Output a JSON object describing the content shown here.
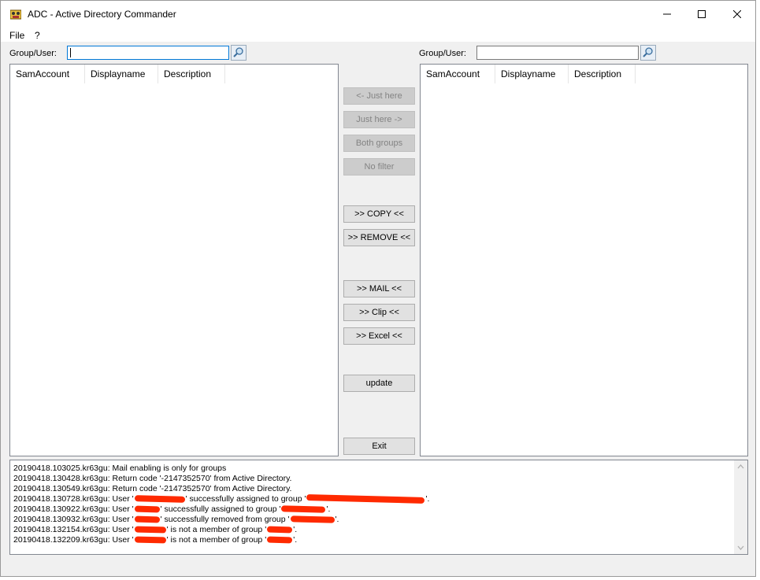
{
  "window": {
    "title": "ADC - Active Directory Commander"
  },
  "menu": [
    "File",
    "?"
  ],
  "left_panel": {
    "label": "Group/User:",
    "input_value": "",
    "columns": [
      "SamAccount",
      "Displayname",
      "Description"
    ]
  },
  "right_panel": {
    "label": "Group/User:",
    "input_value": "",
    "columns": [
      "SamAccount",
      "Displayname",
      "Description"
    ]
  },
  "buttons": {
    "just_here_left": "<- Just here",
    "just_here_right": "Just here ->",
    "both_groups": "Both groups",
    "no_filter": "No filter",
    "copy": ">> COPY <<",
    "remove": ">> REMOVE <<",
    "mail": ">> MAIL <<",
    "clip": ">> Clip <<",
    "excel": ">> Excel <<",
    "update": "update",
    "exit": "Exit"
  },
  "log": [
    {
      "pre": "20190418.103025.kr63gu: Mail enabling is only for groups"
    },
    {
      "pre": "20190418.130428.kr63gu: Return code '-2147352570' from Active Directory."
    },
    {
      "pre": "20190418.130549.kr63gu: Return code '-2147352570' from Active Directory."
    },
    {
      "pre": "20190418.130728.kr63gu: User '",
      "mid": "' successfully assigned to group '",
      "post": "'."
    },
    {
      "pre": "20190418.130922.kr63gu: User '",
      "mid": "' successfully assigned to group '",
      "post": "'."
    },
    {
      "pre": "20190418.130932.kr63gu: User '",
      "mid": "' successfully removed from group '",
      "post": "'."
    },
    {
      "pre": "20190418.132154.kr63gu: User '",
      "mid": "' is not a member of group '",
      "post": "'."
    },
    {
      "pre": "20190418.132209.kr63gu: User '",
      "mid": "' is not a member of group '",
      "post": "'."
    }
  ],
  "colors": {
    "redaction": "#ff2a00",
    "focus_border": "#0078d7"
  }
}
